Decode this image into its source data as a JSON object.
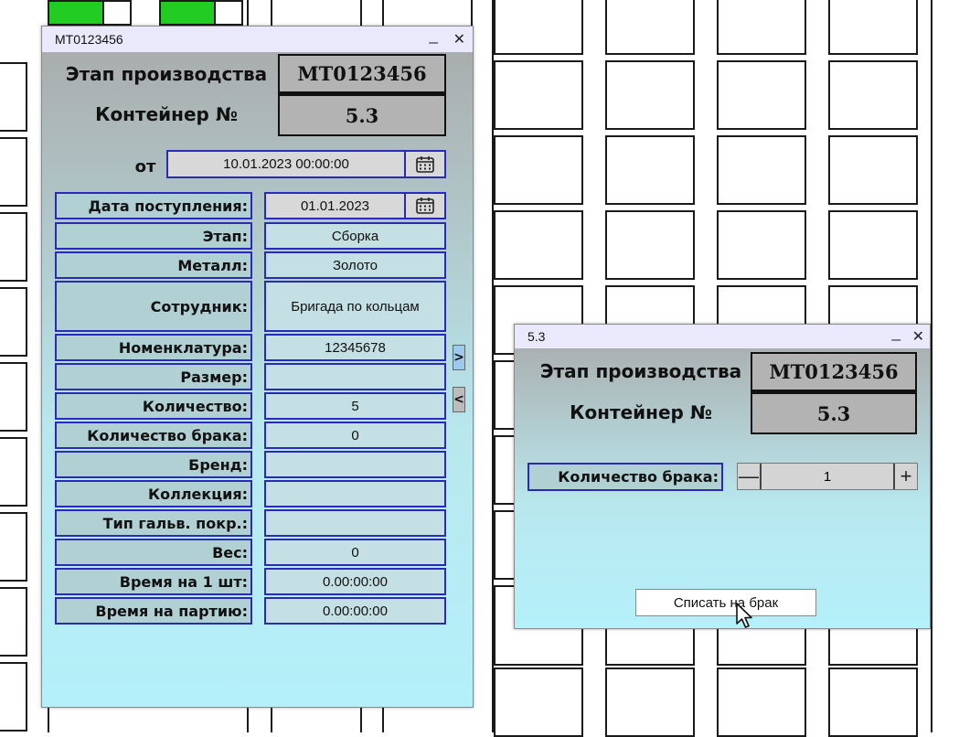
{
  "window_main": {
    "title": "МТ0123456",
    "minimize_glyph": "_",
    "close_glyph": "✕",
    "header": {
      "stage_label": "Этап производства",
      "stage_value": "МТ0123456",
      "container_label": "Контейнер №",
      "container_value": "5.3"
    },
    "from_label": "от",
    "from_value": "10.01.2023 00:00:00",
    "fields": [
      {
        "label": "Дата поступления:",
        "value": "01.01.2023"
      },
      {
        "label": "Этап:",
        "value": "Сборка"
      },
      {
        "label": "Металл:",
        "value": "Золото"
      },
      {
        "label": "Сотрудник:",
        "value": "Бригада по кольцам"
      },
      {
        "label": "Номенклатура:",
        "value": "12345678"
      },
      {
        "label": "Размер:",
        "value": ""
      },
      {
        "label": "Количество:",
        "value": "5"
      },
      {
        "label": "Количество брака:",
        "value": "0"
      },
      {
        "label": "Бренд:",
        "value": ""
      },
      {
        "label": "Коллекция:",
        "value": ""
      },
      {
        "label": "Тип гальв. покр.:",
        "value": ""
      },
      {
        "label": "Вес:",
        "value": "0"
      },
      {
        "label": "Время на 1 шт:",
        "value": "0.00:00:00"
      },
      {
        "label": "Время на партию:",
        "value": "0.00:00:00"
      }
    ],
    "next_glyph": ">",
    "prev_glyph": "<"
  },
  "window_dialog": {
    "title": "5.3",
    "minimize_glyph": "_",
    "close_glyph": "✕",
    "header": {
      "stage_label": "Этап производства",
      "stage_value": "МТ0123456",
      "container_label": "Контейнер №",
      "container_value": "5.3"
    },
    "defect_label": "Количество брака:",
    "defect_value": "1",
    "minus_glyph": "—",
    "plus_glyph": "+",
    "writeoff_button": "Списать на брак"
  },
  "icons": [
    "calendar-icon",
    "mouse-cursor-icon"
  ],
  "colors": {
    "field_border": "#2a2ab8",
    "titlebar": "#e9e9fb",
    "status_green": "#22cc22"
  }
}
